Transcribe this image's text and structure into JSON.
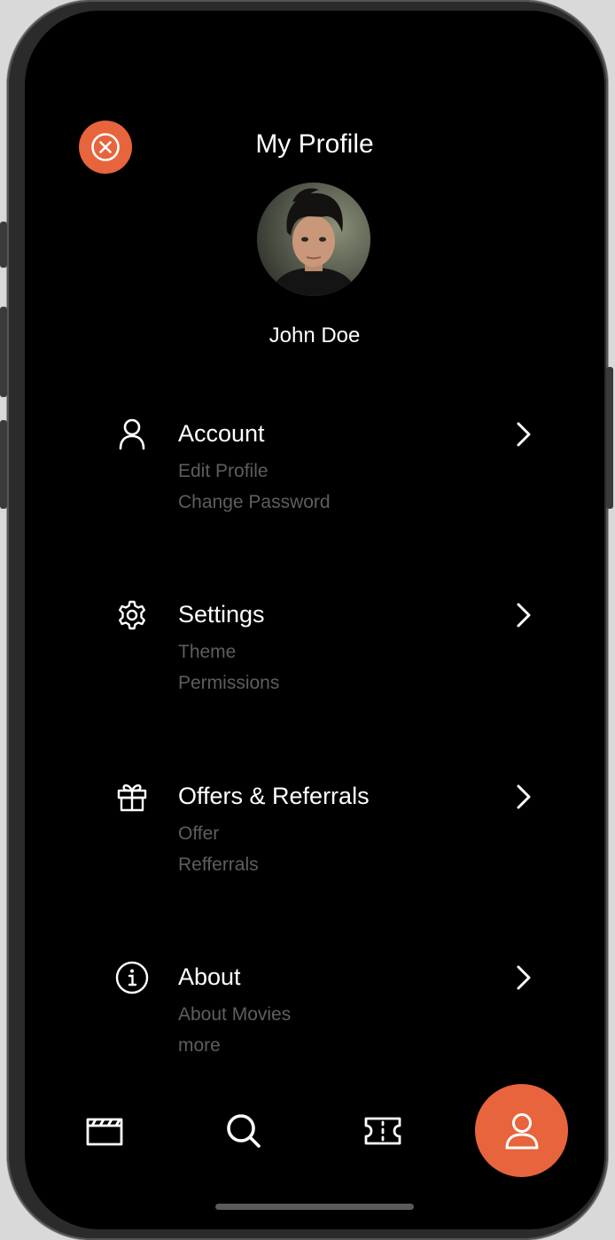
{
  "header": {
    "title": "My Profile",
    "close_icon": "close-circle-icon",
    "accent_color": "#e8643c"
  },
  "profile": {
    "name": "John Doe",
    "avatar": "profile-photo"
  },
  "menu": [
    {
      "title": "Account",
      "icon": "user-icon",
      "subitems": [
        "Edit Profile",
        "Change Password"
      ]
    },
    {
      "title": "Settings",
      "icon": "gear-icon",
      "subitems": [
        "Theme",
        "Permissions"
      ]
    },
    {
      "title": "Offers & Referrals",
      "icon": "gift-icon",
      "subitems": [
        "Offer",
        "Refferrals"
      ]
    },
    {
      "title": "About",
      "icon": "info-icon",
      "subitems": [
        "About Movies",
        "more"
      ]
    }
  ],
  "tabbar": {
    "tabs": [
      {
        "icon": "clapperboard-icon",
        "active": false
      },
      {
        "icon": "search-icon",
        "active": false
      },
      {
        "icon": "ticket-icon",
        "active": false
      },
      {
        "icon": "user-icon",
        "active": true
      }
    ]
  },
  "colors": {
    "background": "#000000",
    "subtext": "#5e5e5e",
    "text": "#ffffff"
  }
}
